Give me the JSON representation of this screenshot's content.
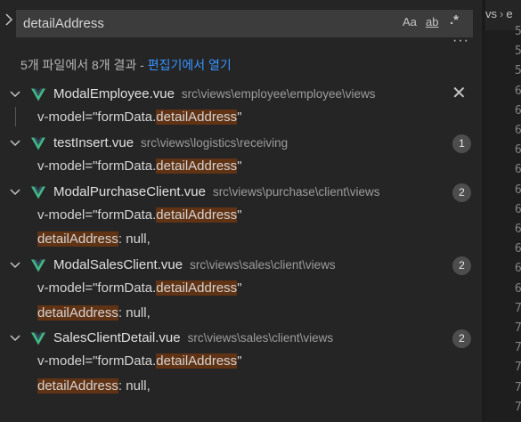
{
  "search": {
    "query": "detailAddress",
    "case_label": "Aa",
    "word_label": "ab",
    "regex_label": ".*"
  },
  "summary": {
    "text": "5개 파일에서 8개 결과 - ",
    "link": "편집기에서 열기"
  },
  "files": [
    {
      "name": "ModalEmployee.vue",
      "path": "src\\views\\employee\\employee\\views",
      "count": "",
      "matches": [
        {
          "pre": "v-model=\"formData.",
          "hit": "detailAddress",
          "post": "\""
        }
      ]
    },
    {
      "name": "testInsert.vue",
      "path": "src\\views\\logistics\\receiving",
      "count": "1",
      "matches": [
        {
          "pre": "v-model=\"formData.",
          "hit": "detailAddress",
          "post": "\""
        }
      ]
    },
    {
      "name": "ModalPurchaseClient.vue",
      "path": "src\\views\\purchase\\client\\views",
      "count": "2",
      "matches": [
        {
          "pre": "v-model=\"formData.",
          "hit": "detailAddress",
          "post": "\""
        },
        {
          "pre": "",
          "hit": "detailAddress",
          "post": ": null,"
        }
      ]
    },
    {
      "name": "ModalSalesClient.vue",
      "path": "src\\views\\sales\\client\\views",
      "count": "2",
      "matches": [
        {
          "pre": "v-model=\"formData.",
          "hit": "detailAddress",
          "post": "\""
        },
        {
          "pre": "",
          "hit": "detailAddress",
          "post": ": null,"
        }
      ]
    },
    {
      "name": "SalesClientDetail.vue",
      "path": "src\\views\\sales\\client\\views",
      "count": "2",
      "matches": [
        {
          "pre": "v-model=\"formData.",
          "hit": "detailAddress",
          "post": "\""
        },
        {
          "pre": "",
          "hit": "detailAddress",
          "post": ": null,"
        }
      ]
    }
  ],
  "editor": {
    "tab_prefix": "vs",
    "tab_next": "e",
    "line_numbers": [
      "5",
      "5",
      "5",
      "6",
      "6",
      "6",
      "6",
      "6",
      "6",
      "6",
      "6",
      "6",
      "6",
      "6",
      "7",
      "7",
      "7",
      "7",
      "7",
      "7"
    ]
  },
  "colors": {
    "vue_green": "#41b883",
    "match_highlight": "#613315",
    "link": "#3794ff"
  }
}
